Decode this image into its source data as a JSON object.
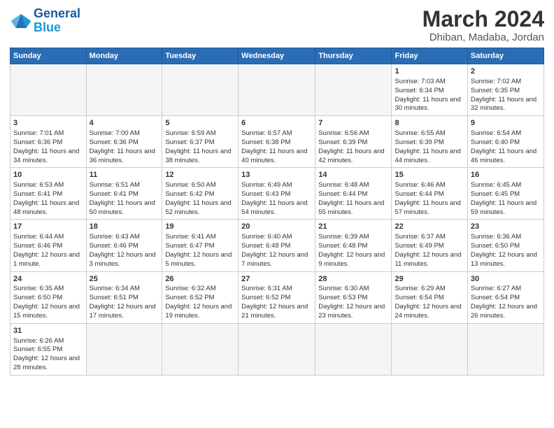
{
  "logo": {
    "text_general": "General",
    "text_blue": "Blue"
  },
  "header": {
    "title": "March 2024",
    "subtitle": "Dhiban, Madaba, Jordan"
  },
  "weekdays": [
    "Sunday",
    "Monday",
    "Tuesday",
    "Wednesday",
    "Thursday",
    "Friday",
    "Saturday"
  ],
  "weeks": [
    [
      {
        "day": "",
        "empty": true
      },
      {
        "day": "",
        "empty": true
      },
      {
        "day": "",
        "empty": true
      },
      {
        "day": "",
        "empty": true
      },
      {
        "day": "",
        "empty": true
      },
      {
        "day": "1",
        "sunrise": "7:03 AM",
        "sunset": "6:34 PM",
        "daylight": "11 hours and 30 minutes."
      },
      {
        "day": "2",
        "sunrise": "7:02 AM",
        "sunset": "6:35 PM",
        "daylight": "11 hours and 32 minutes."
      }
    ],
    [
      {
        "day": "3",
        "sunrise": "7:01 AM",
        "sunset": "6:36 PM",
        "daylight": "11 hours and 34 minutes."
      },
      {
        "day": "4",
        "sunrise": "7:00 AM",
        "sunset": "6:36 PM",
        "daylight": "11 hours and 36 minutes."
      },
      {
        "day": "5",
        "sunrise": "6:59 AM",
        "sunset": "6:37 PM",
        "daylight": "11 hours and 38 minutes."
      },
      {
        "day": "6",
        "sunrise": "6:57 AM",
        "sunset": "6:38 PM",
        "daylight": "11 hours and 40 minutes."
      },
      {
        "day": "7",
        "sunrise": "6:56 AM",
        "sunset": "6:39 PM",
        "daylight": "11 hours and 42 minutes."
      },
      {
        "day": "8",
        "sunrise": "6:55 AM",
        "sunset": "6:39 PM",
        "daylight": "11 hours and 44 minutes."
      },
      {
        "day": "9",
        "sunrise": "6:54 AM",
        "sunset": "6:40 PM",
        "daylight": "11 hours and 46 minutes."
      }
    ],
    [
      {
        "day": "10",
        "sunrise": "6:53 AM",
        "sunset": "6:41 PM",
        "daylight": "11 hours and 48 minutes."
      },
      {
        "day": "11",
        "sunrise": "6:51 AM",
        "sunset": "6:41 PM",
        "daylight": "11 hours and 50 minutes."
      },
      {
        "day": "12",
        "sunrise": "6:50 AM",
        "sunset": "6:42 PM",
        "daylight": "11 hours and 52 minutes."
      },
      {
        "day": "13",
        "sunrise": "6:49 AM",
        "sunset": "6:43 PM",
        "daylight": "11 hours and 54 minutes."
      },
      {
        "day": "14",
        "sunrise": "6:48 AM",
        "sunset": "6:44 PM",
        "daylight": "11 hours and 55 minutes."
      },
      {
        "day": "15",
        "sunrise": "6:46 AM",
        "sunset": "6:44 PM",
        "daylight": "11 hours and 57 minutes."
      },
      {
        "day": "16",
        "sunrise": "6:45 AM",
        "sunset": "6:45 PM",
        "daylight": "11 hours and 59 minutes."
      }
    ],
    [
      {
        "day": "17",
        "sunrise": "6:44 AM",
        "sunset": "6:46 PM",
        "daylight": "12 hours and 1 minute."
      },
      {
        "day": "18",
        "sunrise": "6:43 AM",
        "sunset": "6:46 PM",
        "daylight": "12 hours and 3 minutes."
      },
      {
        "day": "19",
        "sunrise": "6:41 AM",
        "sunset": "6:47 PM",
        "daylight": "12 hours and 5 minutes."
      },
      {
        "day": "20",
        "sunrise": "6:40 AM",
        "sunset": "6:48 PM",
        "daylight": "12 hours and 7 minutes."
      },
      {
        "day": "21",
        "sunrise": "6:39 AM",
        "sunset": "6:48 PM",
        "daylight": "12 hours and 9 minutes."
      },
      {
        "day": "22",
        "sunrise": "6:37 AM",
        "sunset": "6:49 PM",
        "daylight": "12 hours and 11 minutes."
      },
      {
        "day": "23",
        "sunrise": "6:36 AM",
        "sunset": "6:50 PM",
        "daylight": "12 hours and 13 minutes."
      }
    ],
    [
      {
        "day": "24",
        "sunrise": "6:35 AM",
        "sunset": "6:50 PM",
        "daylight": "12 hours and 15 minutes."
      },
      {
        "day": "25",
        "sunrise": "6:34 AM",
        "sunset": "6:51 PM",
        "daylight": "12 hours and 17 minutes."
      },
      {
        "day": "26",
        "sunrise": "6:32 AM",
        "sunset": "6:52 PM",
        "daylight": "12 hours and 19 minutes."
      },
      {
        "day": "27",
        "sunrise": "6:31 AM",
        "sunset": "6:52 PM",
        "daylight": "12 hours and 21 minutes."
      },
      {
        "day": "28",
        "sunrise": "6:30 AM",
        "sunset": "6:53 PM",
        "daylight": "12 hours and 23 minutes."
      },
      {
        "day": "29",
        "sunrise": "6:29 AM",
        "sunset": "6:54 PM",
        "daylight": "12 hours and 24 minutes."
      },
      {
        "day": "30",
        "sunrise": "6:27 AM",
        "sunset": "6:54 PM",
        "daylight": "12 hours and 26 minutes."
      }
    ],
    [
      {
        "day": "31",
        "sunrise": "6:26 AM",
        "sunset": "6:55 PM",
        "daylight": "12 hours and 28 minutes."
      },
      {
        "day": "",
        "empty": true
      },
      {
        "day": "",
        "empty": true
      },
      {
        "day": "",
        "empty": true
      },
      {
        "day": "",
        "empty": true
      },
      {
        "day": "",
        "empty": true
      },
      {
        "day": "",
        "empty": true
      }
    ]
  ]
}
